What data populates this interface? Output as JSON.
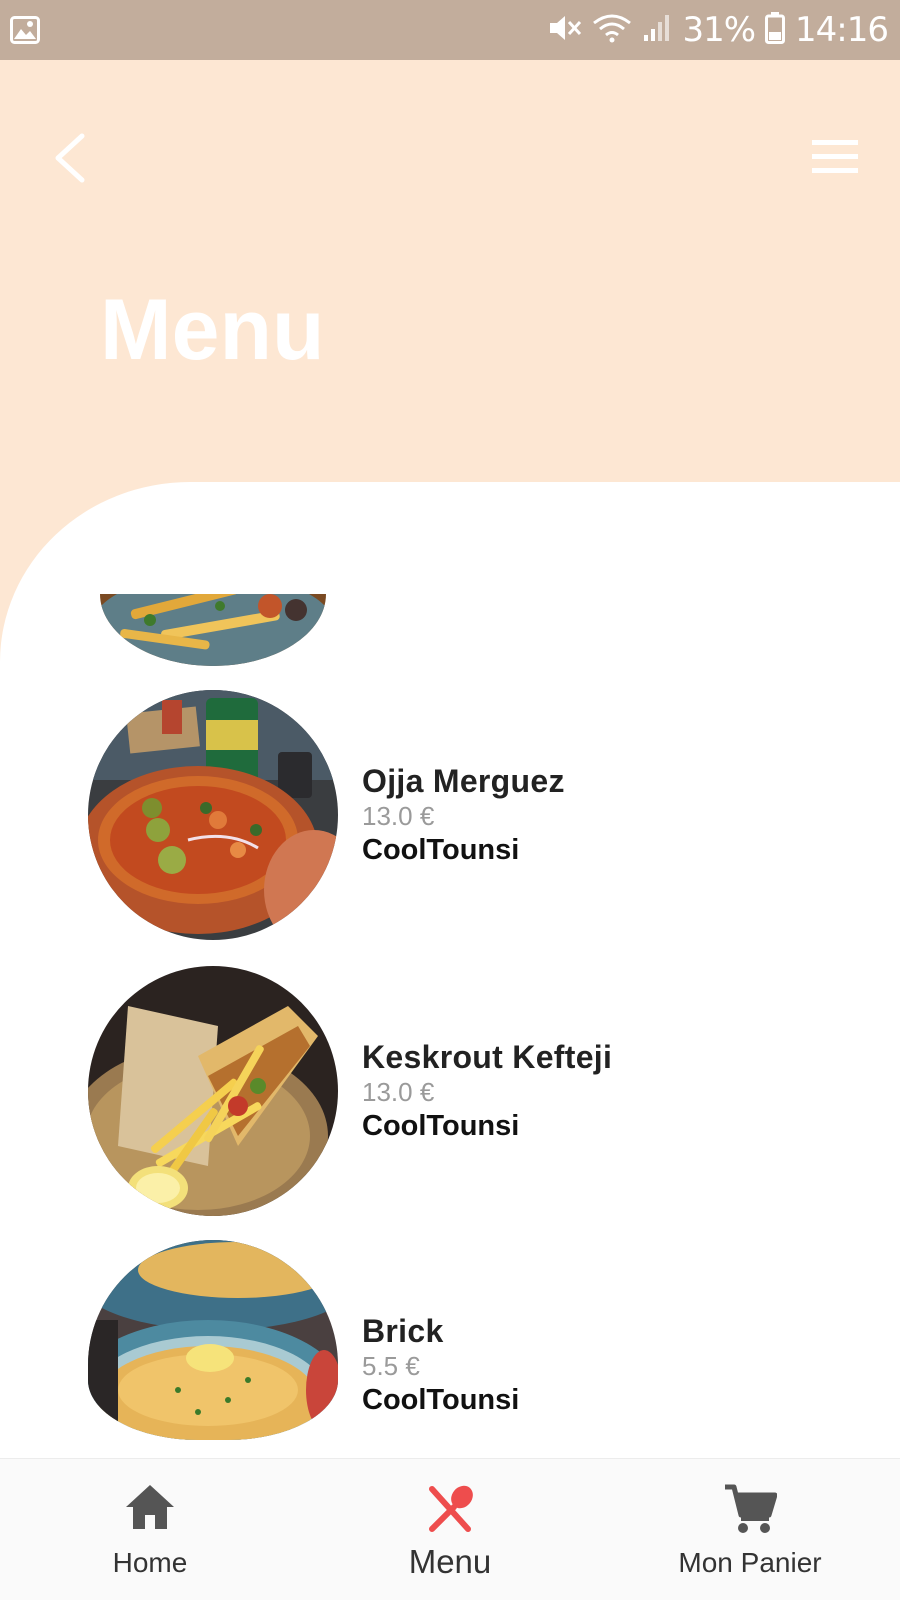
{
  "status_bar": {
    "battery": "31%",
    "time": "14:16"
  },
  "header": {
    "title": "Menu"
  },
  "menu_items": [
    {
      "name": "Ojja Merguez",
      "price": "13.0 €",
      "restaurant": "CoolTounsi"
    },
    {
      "name": "Keskrout Kefteji",
      "price": "13.0 €",
      "restaurant": "CoolTounsi"
    },
    {
      "name": "Brick",
      "price": "5.5 €",
      "restaurant": "CoolTounsi"
    }
  ],
  "bottom_nav": {
    "items": [
      {
        "label": "Home",
        "icon": "home-icon"
      },
      {
        "label": "Menu",
        "icon": "fork-spoon-icon",
        "active": true
      },
      {
        "label": "Mon Panier",
        "icon": "cart-icon"
      }
    ],
    "active_color": "#ee4d4d",
    "inactive_color": "#555555"
  },
  "colors": {
    "header_background": "#fde7d3",
    "status_bar_background": "#c2ad9c",
    "sheet_background": "#ffffff"
  }
}
